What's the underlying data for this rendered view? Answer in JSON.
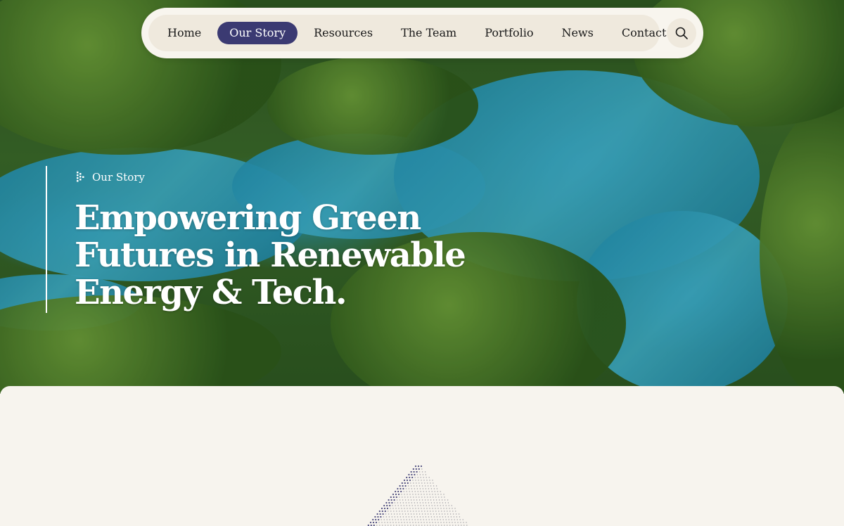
{
  "nav": {
    "items": [
      {
        "label": "Home",
        "active": false
      },
      {
        "label": "Our Story",
        "active": true
      },
      {
        "label": "Resources",
        "active": false
      },
      {
        "label": "The Team",
        "active": false
      },
      {
        "label": "Portfolio",
        "active": false
      },
      {
        "label": "News",
        "active": false
      },
      {
        "label": "Contact",
        "active": false
      }
    ],
    "search_icon": "search-icon",
    "active_color": "#3b3a72"
  },
  "hero": {
    "eyebrow": "Our Story",
    "title": "Empowering Green Futures in Renewable Energy & Tech."
  },
  "colors": {
    "accent": "#3b3a72",
    "background": "#f7f4ee",
    "nav_background": "#efe9dd"
  }
}
